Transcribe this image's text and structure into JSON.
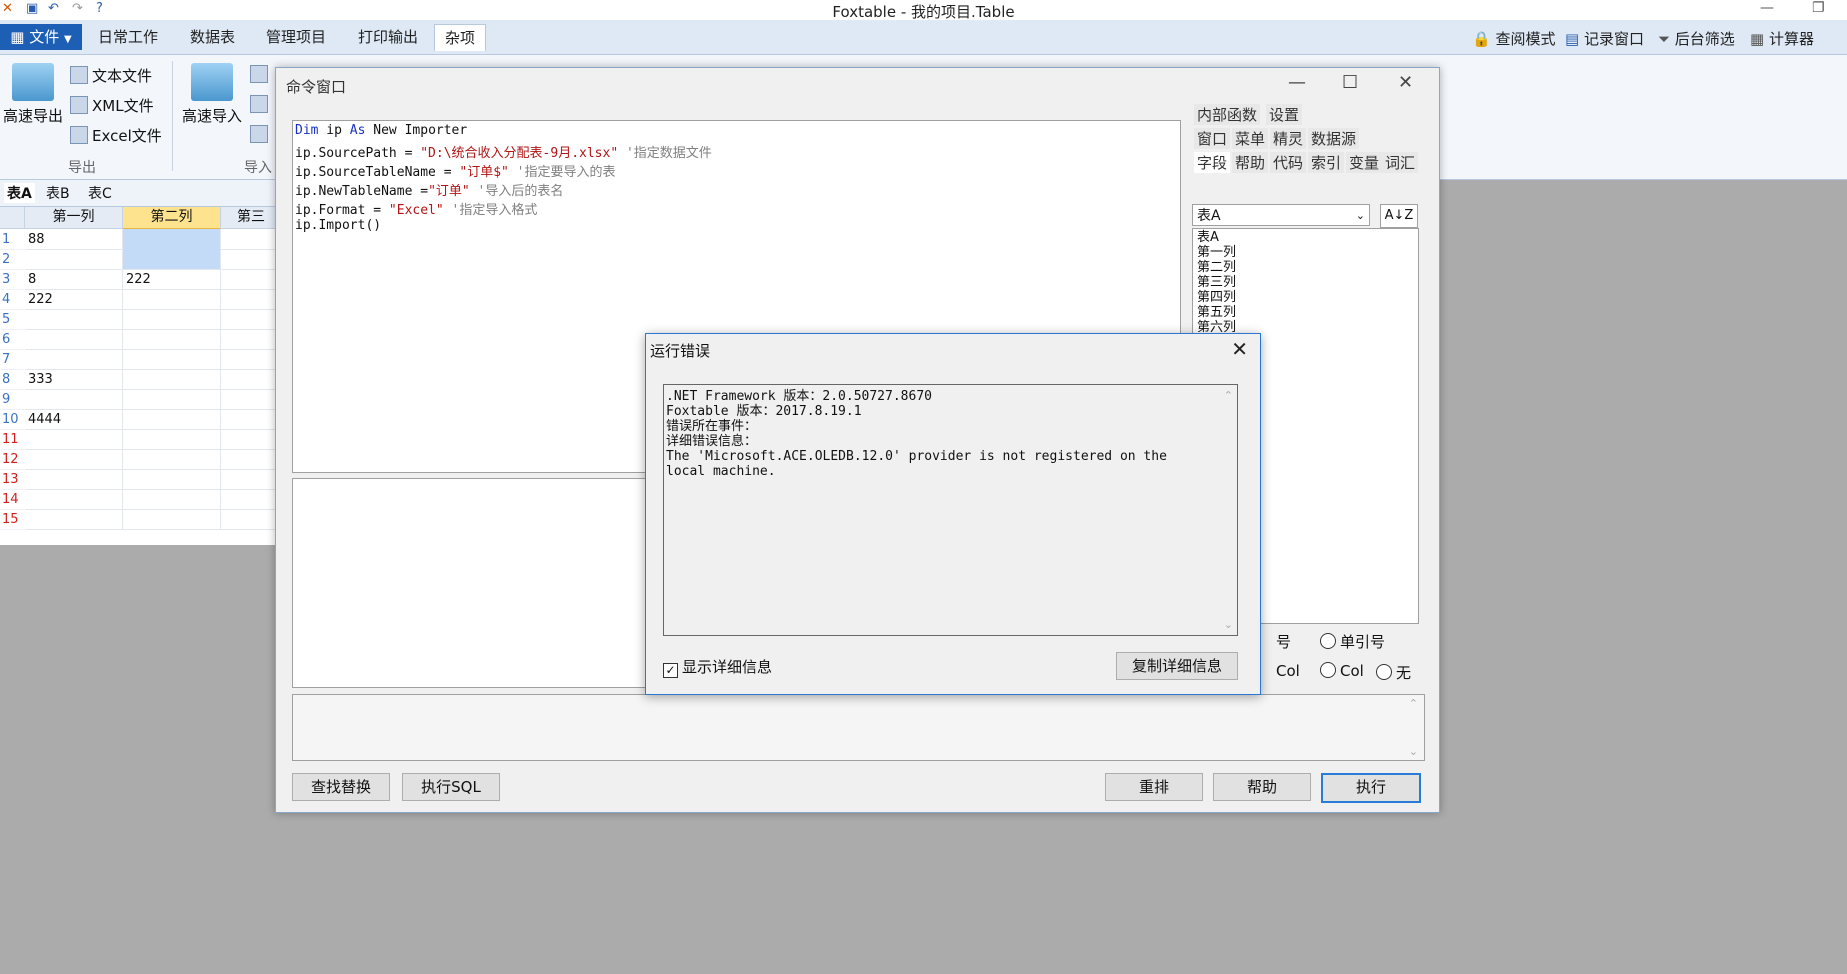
{
  "app_title": "Foxtable - 我的项目.Table",
  "ribbon": {
    "file_label": "文件",
    "tabs": [
      "日常工作",
      "数据表",
      "管理项目",
      "打印输出",
      "杂项"
    ],
    "right_tools": [
      "查阅模式",
      "记录窗口",
      "后台筛选",
      "计算器"
    ],
    "export_big_label": "高速导出",
    "export_items": [
      "文本文件",
      "XML文件",
      "Excel文件"
    ],
    "export_group": "导出",
    "import_big_label": "高速导入",
    "import_group": "导入"
  },
  "sheet_tabs": [
    "表A",
    "表B",
    "表C"
  ],
  "grid": {
    "columns": [
      "第一列",
      "第二列",
      "第三"
    ],
    "row_numbers": [
      "1",
      "2",
      "3",
      "4",
      "5",
      "6",
      "7",
      "8",
      "9",
      "10",
      "11",
      "12",
      "13",
      "14",
      "15"
    ],
    "rows": [
      [
        "88",
        ""
      ],
      [
        "",
        ""
      ],
      [
        "8",
        "222"
      ],
      [
        "222",
        ""
      ],
      [
        "",
        ""
      ],
      [
        "",
        ""
      ],
      [
        "",
        ""
      ],
      [
        "333",
        ""
      ],
      [
        "",
        ""
      ],
      [
        "4444",
        ""
      ],
      [
        "",
        ""
      ],
      [
        "",
        ""
      ],
      [
        "",
        ""
      ],
      [
        "",
        ""
      ],
      [
        "",
        ""
      ]
    ]
  },
  "command_window": {
    "title": "命令窗口",
    "code": {
      "l1_kw1": "Dim",
      "l1_a": " ip ",
      "l1_kw2": "As",
      "l1_b": " New Importer",
      "l2_a": "ip.SourcePath = ",
      "l2_str": "\"D:\\统合收入分配表-9月.xlsx\"",
      "l2_cm": " '指定数据文件",
      "l3_a": "ip.SourceTableName = ",
      "l3_str": "\"订单$\"",
      "l3_cm": " '指定要导入的表",
      "l4_a": "ip.NewTableName =",
      "l4_str": "\"订单\"",
      "l4_cm": " '导入后的表名",
      "l5_a": "ip.Format = ",
      "l5_str": "\"Excel\"",
      "l5_cm": " '指定导入格式",
      "l6_a": "ip.Import()"
    },
    "right_tabs_row1": [
      "内部函数",
      "设置"
    ],
    "right_tabs_row2": [
      "窗口",
      "菜单",
      "精灵",
      "数据源"
    ],
    "right_tabs_row3": [
      "字段",
      "帮助",
      "代码",
      "索引",
      "变量",
      "词汇"
    ],
    "table_select": "表A",
    "sort_button": "A↓Z",
    "field_list": [
      "表A",
      "第一列",
      "第二列",
      "第三列",
      "第四列",
      "第五列",
      "第六列"
    ],
    "radio_row1": [
      "号",
      "单引号"
    ],
    "radio_row2": [
      "Col",
      "Col",
      "无"
    ],
    "buttons": {
      "find_replace": "查找替换",
      "exec_sql": "执行SQL",
      "reset": "重排",
      "help": "帮助",
      "execute": "执行"
    }
  },
  "error_dialog": {
    "title": "运行错误",
    "lines": [
      ".NET Framework 版本：2.0.50727.8670",
      "Foxtable 版本：2017.8.19.1",
      "错误所在事件：",
      "详细错误信息：",
      "The 'Microsoft.ACE.OLEDB.12.0' provider is not registered on the",
      "local machine."
    ],
    "show_detail_label": "显示详细信息",
    "show_detail_checked": true,
    "copy_button": "复制详细信息"
  }
}
